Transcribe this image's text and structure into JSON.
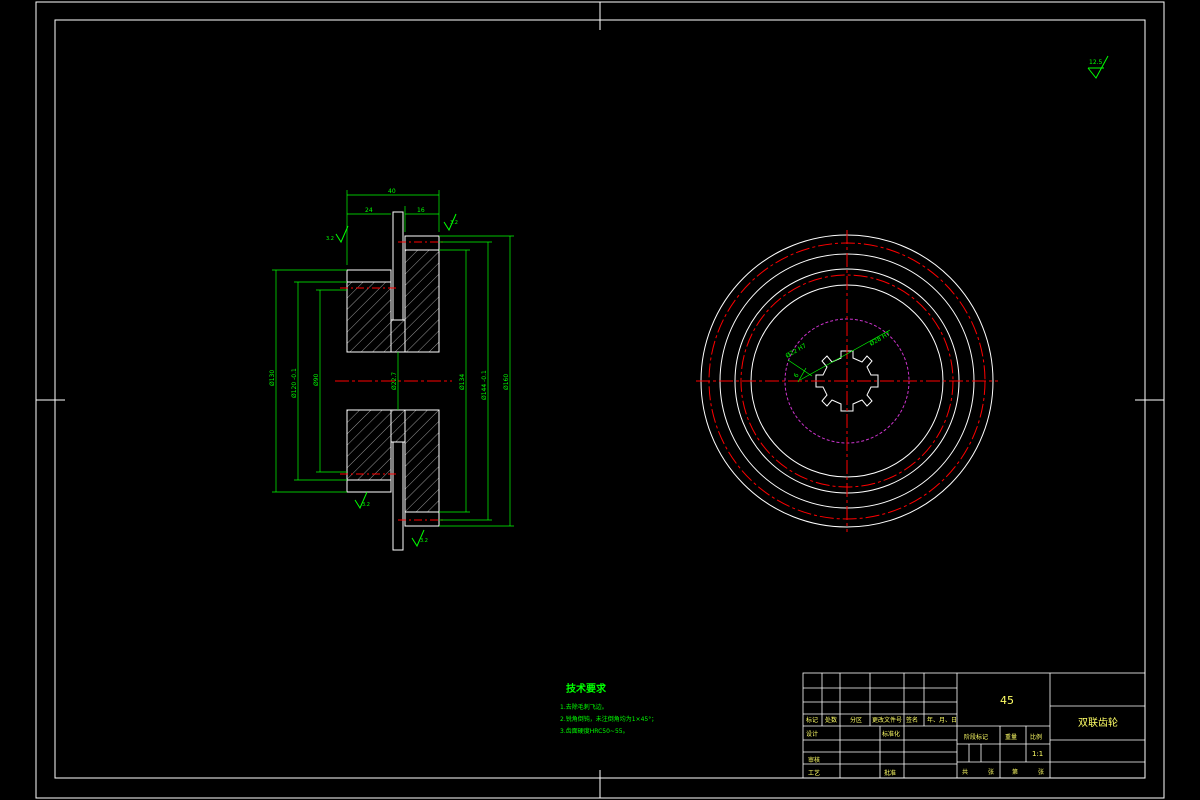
{
  "colors": {
    "background": "#000000",
    "frame": "#ffffff",
    "dimension": "#00ff00",
    "centerline": "#ff0000",
    "pitch": "#cc33cc",
    "hatch": "#ffffff",
    "title_text": "#ffff66",
    "notes_text": "#00ff00"
  },
  "drawing": {
    "surface_finish_general": "12.5",
    "side_view": {
      "dim_overall_width": "40",
      "dim_left_hub": "24",
      "dim_right_hub": "16",
      "roughness_top_left": "3.2",
      "roughness_top_right": "3.2",
      "roughness_bottom_left": "3.2",
      "roughness_bottom_right": "3.2",
      "dia_left_outer": "Ø130",
      "dia_left_tip": "Ø120 -0.1",
      "dia_left_root": "Ø90",
      "dia_bore": "Ø22.7",
      "dia_right_root": "Ø134",
      "dia_right_tip": "Ø144 -0.1",
      "dia_right_outer": "Ø160"
    },
    "front_view": {
      "spline_label_1": "Ø28 H7",
      "spline_label_2": "Ø22 H7",
      "spline_label_3": "6"
    }
  },
  "notes": {
    "title": "技术要求",
    "items": [
      "1.去除毛刺飞边。",
      "2.锐角倒钝，未注倒角均为1×45°；",
      "3.齿面硬度HRC50~55。"
    ]
  },
  "title_block": {
    "material": "45",
    "part_name": "双联齿轮",
    "scale": "1:1",
    "row_labels": [
      "标记",
      "处数",
      "分区",
      "更改文件号",
      "签名",
      "年、月、日"
    ],
    "design_label": "设计",
    "standardize_label": "标准化",
    "review_label": "审核",
    "process_label": "工艺",
    "approve_label": "批准",
    "stage_label": "阶段标记",
    "weight_label": "重量",
    "scale_label": "比例",
    "sheet_total": "共",
    "sheet_label": "张",
    "sheet_no": "第",
    "sheet_label2": "张"
  }
}
